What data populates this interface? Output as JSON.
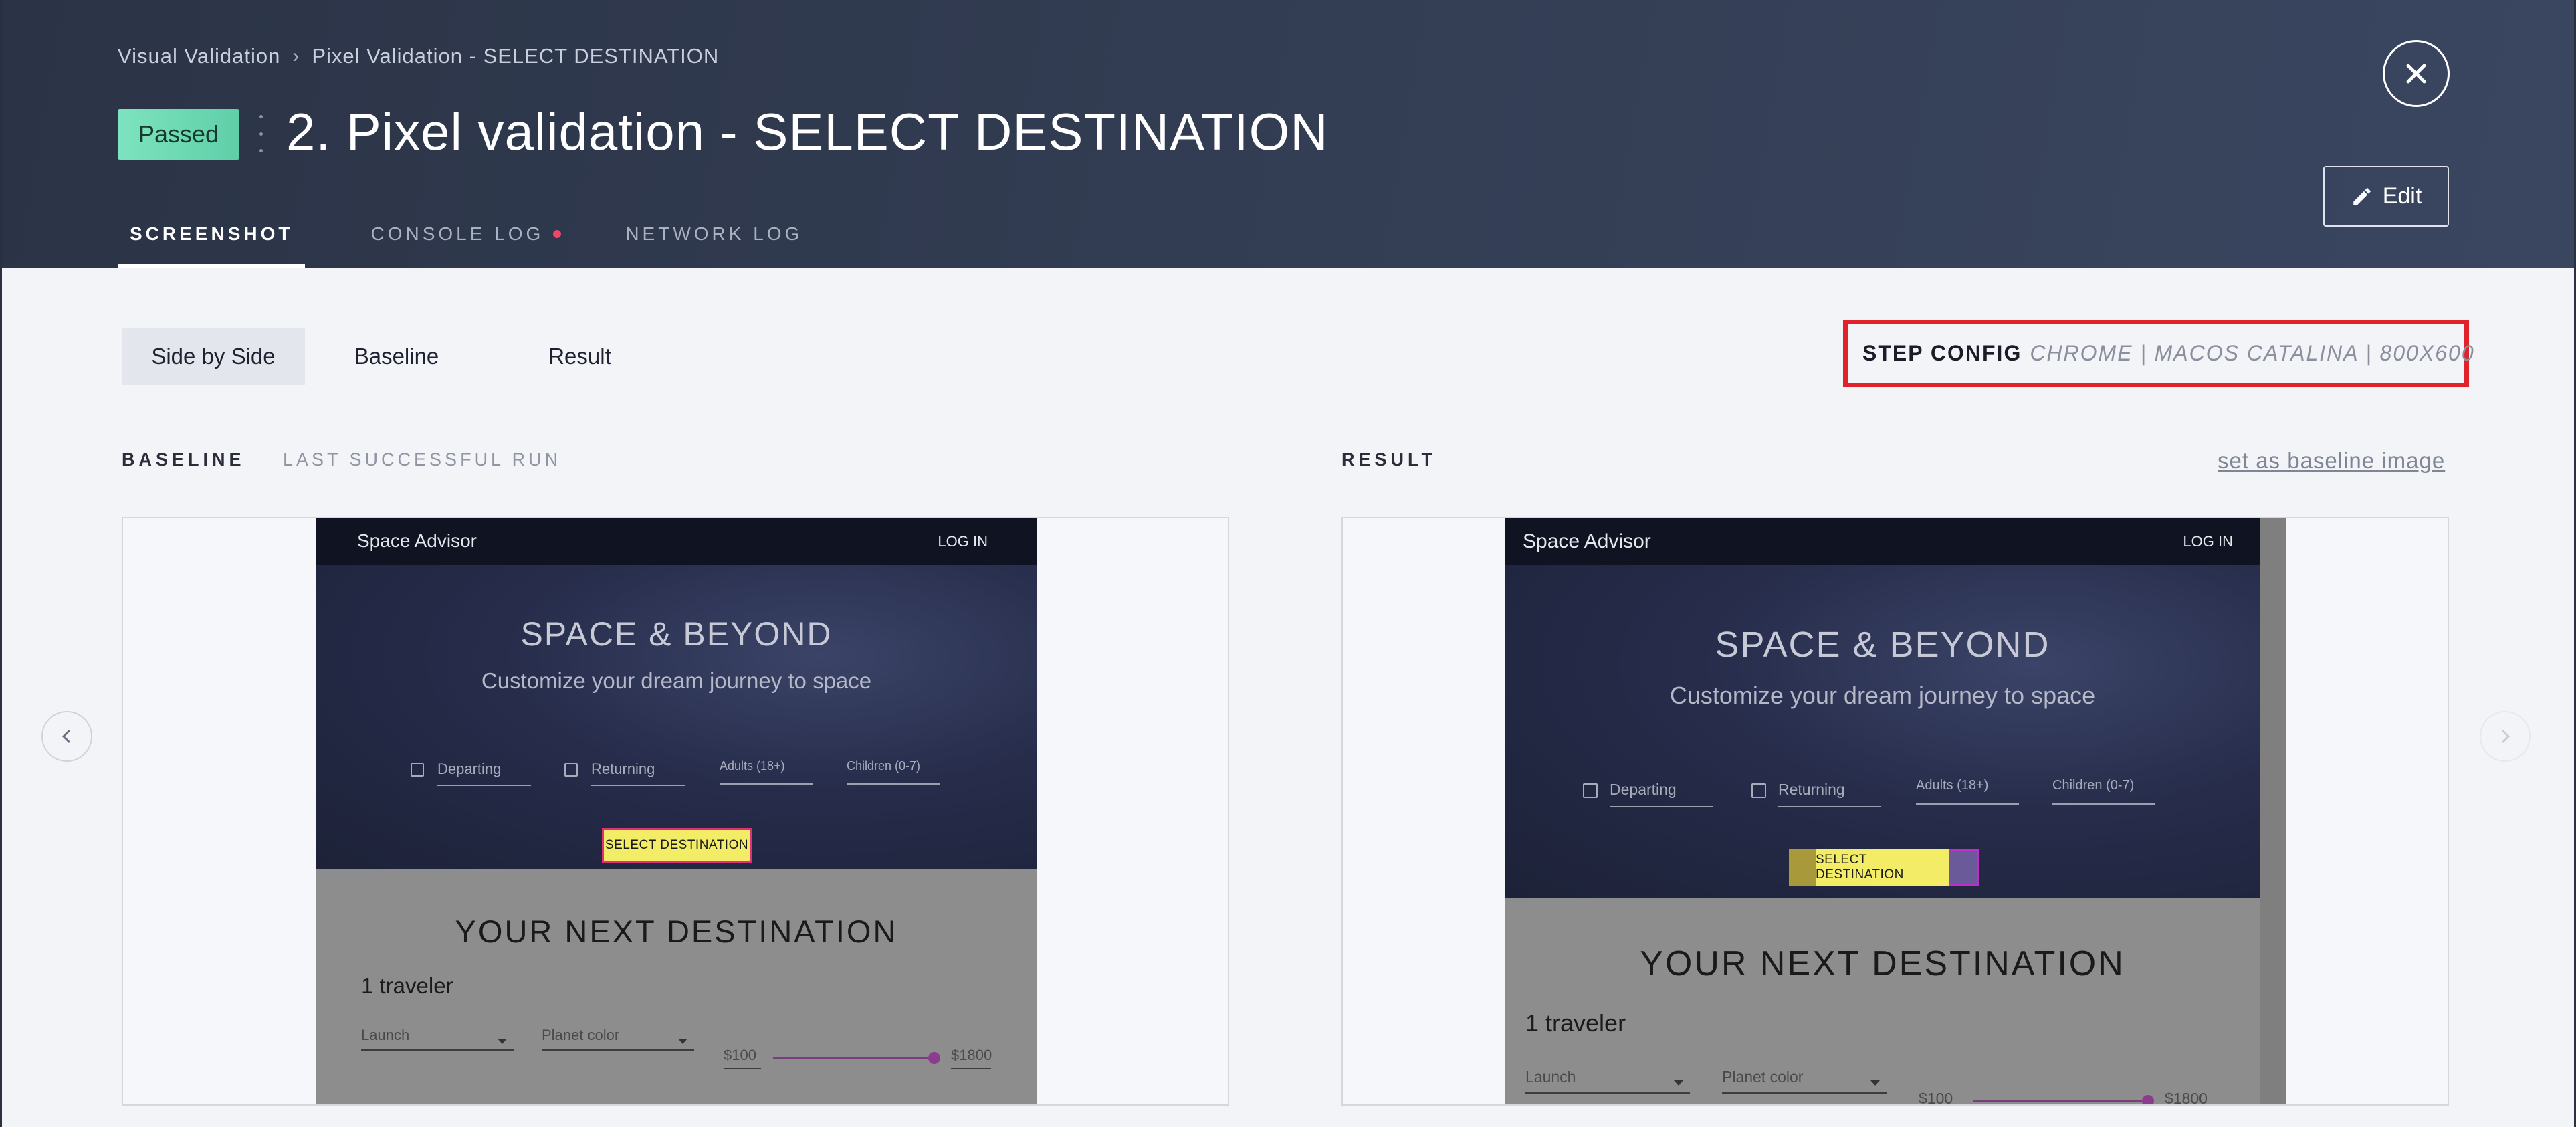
{
  "breadcrumb": {
    "root": "Visual Validation",
    "current": "Pixel Validation - SELECT DESTINATION"
  },
  "status": {
    "label": "Passed",
    "color": "#6ad8b2"
  },
  "title": "2. Pixel validation - SELECT DESTINATION",
  "actions": {
    "edit_label": "Edit",
    "close_icon": "close-icon"
  },
  "tabs": [
    {
      "label": "SCREENSHOT",
      "active": true
    },
    {
      "label": "CONSOLE LOG",
      "active": false,
      "indicator_color": "#f0456a"
    },
    {
      "label": "NETWORK LOG",
      "active": false
    }
  ],
  "view_modes": [
    {
      "label": "Side by Side",
      "active": true
    },
    {
      "label": "Baseline",
      "active": false
    },
    {
      "label": "Result",
      "active": false
    }
  ],
  "step_config": {
    "label": "STEP CONFIG",
    "value": "CHROME | MACOS CATALINA | 800X600",
    "highlight_color": "#e0222b"
  },
  "baseline_panel": {
    "label": "BASELINE",
    "sublabel": "LAST SUCCESSFUL RUN"
  },
  "result_panel": {
    "label": "RESULT",
    "set_baseline_link": "set as baseline image"
  },
  "app_screenshot": {
    "brand": "Space Advisor",
    "login": "LOG IN",
    "hero_title": "SPACE & BEYOND",
    "hero_subtitle": "Customize your dream journey to space",
    "departing": "Departing",
    "returning": "Returning",
    "adults": "Adults (18+)",
    "children": "Children (0-7)",
    "cta": "SELECT DESTINATION",
    "section_title": "YOUR NEXT DESTINATION",
    "travelers": "1 traveler",
    "launch": "Launch",
    "planet_color": "Planet color",
    "price_min": "$100",
    "price_max": "$1800"
  }
}
